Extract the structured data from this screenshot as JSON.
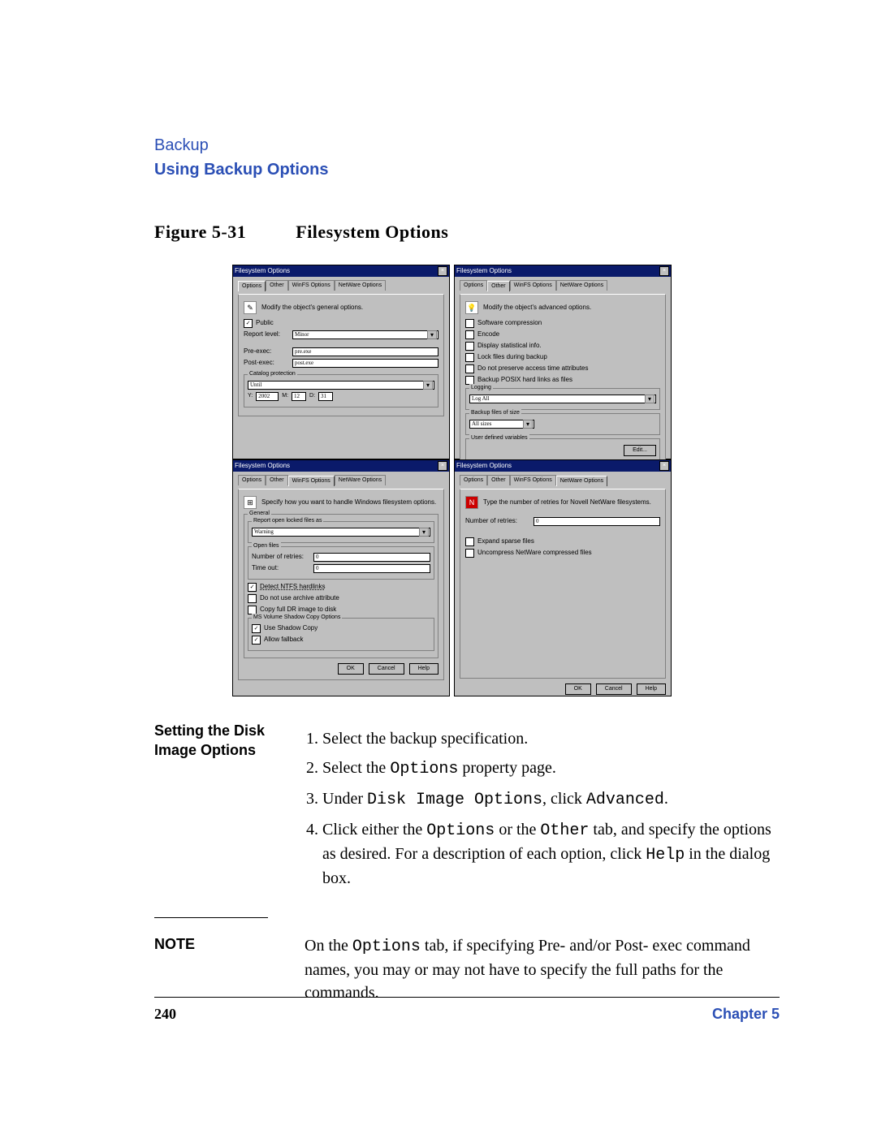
{
  "header": {
    "section": "Backup",
    "subsection": "Using Backup Options"
  },
  "figure": {
    "label": "Figure 5-31",
    "title": "Filesystem Options"
  },
  "dlg_title": "Filesystem Options",
  "tabs": [
    "Options",
    "Other",
    "WinFS Options",
    "NetWare Options"
  ],
  "btns": {
    "ok": "OK",
    "cancel": "Cancel",
    "help": "Help",
    "edit": "Edit..."
  },
  "d1": {
    "hint": "Modify the object's general options.",
    "public": "Public",
    "report_level": "Report level:",
    "report_val": "Minor",
    "pre": "Pre-exec:",
    "pre_val": "pre.exe",
    "post": "Post-exec:",
    "post_val": "post.exe",
    "cat": "Catalog protection",
    "until": "Until",
    "Y": "Y:",
    "Yv": "2002",
    "M": "M:",
    "Mv": "12",
    "D": "D:",
    "Dv": "31"
  },
  "d2": {
    "hint": "Modify the object's advanced options.",
    "c1": "Software compression",
    "c2": "Encode",
    "c3": "Display statistical info.",
    "c4": "Lock files during backup",
    "c5": "Do not preserve access time attributes",
    "c6": "Backup POSIX hard links as files",
    "log": "Logging",
    "log_val": "Log All",
    "bsz": "Backup files of size",
    "bsz_val": "All sizes",
    "udv": "User defined variables"
  },
  "d3": {
    "hint": "Specify how you want to handle Windows filesystem options.",
    "g1": "General",
    "g2": "Report open locked files as",
    "g2v": "Warning",
    "g3": "Open files",
    "nr": "Number of retries:",
    "nrv": "0",
    "to": "Time out:",
    "tov": "0",
    "c1": "Detect NTFS hardlinks",
    "c2": "Do not use archive attribute",
    "c3": "Copy full DR image to disk",
    "g4": "MS Volume Shadow Copy Options",
    "c4": "Use Shadow Copy",
    "c5": "Allow fallback"
  },
  "d4": {
    "hint": "Type the number of retries for Novell NetWare filesystems.",
    "nr": "Number of retries:",
    "nrv": "0",
    "c1": "Expand sparse files",
    "c2": "Uncompress NetWare compressed files"
  },
  "side": {
    "heading": "Setting the Disk Image Options"
  },
  "steps": {
    "s1": "Select the backup specification.",
    "s2a": "Select the ",
    "s2b": "Options",
    "s2c": " property page.",
    "s3a": "Under ",
    "s3b": "Disk Image Options",
    "s3c": ", click ",
    "s3d": "Advanced",
    "s3e": ".",
    "s4a": "Click either the ",
    "s4b": "Options",
    "s4c": " or the ",
    "s4d": "Other",
    "s4e": " tab, and specify the options as desired. For a description of each option, click ",
    "s4f": "Help",
    "s4g": " in the dialog box."
  },
  "note": {
    "label": "NOTE",
    "text_a": "On the ",
    "text_b": "Options",
    "text_c": " tab, if specifying Pre- and/or Post- exec command names, you may or may not have to specify the full paths for the commands."
  },
  "footer": {
    "page": "240",
    "chapter": "Chapter 5"
  }
}
